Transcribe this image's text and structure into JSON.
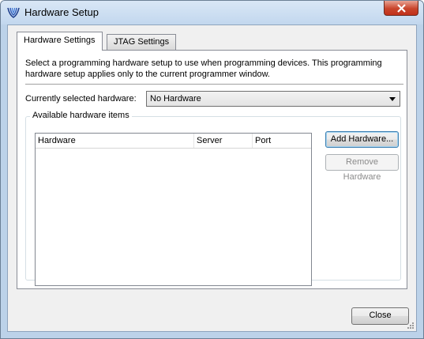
{
  "window": {
    "title": "Hardware Setup",
    "app_icon": "altera-logo-icon",
    "close_icon": "close-icon"
  },
  "tabs": [
    {
      "label": "Hardware Settings",
      "active": true
    },
    {
      "label": "JTAG Settings",
      "active": false
    }
  ],
  "hardware_settings": {
    "description": "Select a programming hardware setup to use when programming devices. This programming hardware setup applies only to the current programmer window.",
    "selected_label": "Currently selected hardware:",
    "selected_value": "No Hardware",
    "available_group": "Available hardware items",
    "columns": [
      "Hardware",
      "Server",
      "Port"
    ],
    "rows": [],
    "add_button": "Add Hardware...",
    "remove_button": "Remove Hardware"
  },
  "footer": {
    "close_button": "Close"
  },
  "colors": {
    "titlebar": "#c2d7ee",
    "close_button": "#c9452c",
    "dialog_bg": "#f0f0f0"
  }
}
